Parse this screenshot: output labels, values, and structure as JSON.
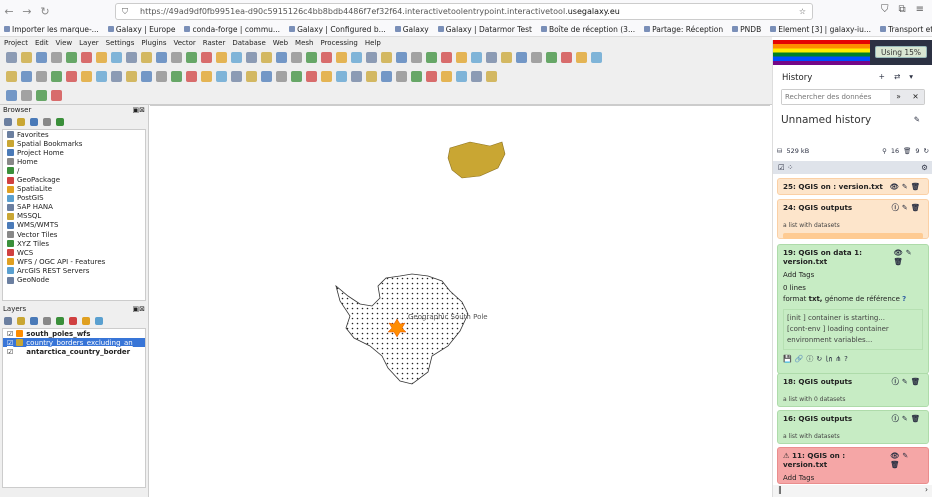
{
  "browser": {
    "url_prefix": "https://49ad9df0fb9951ea-d90c5915126c4bb8bdb4486f7ef32f64.interactivetoolentrypoint.interactivetool.",
    "url_domain": "usegalaxy.eu",
    "bookmarks": [
      "Importer les marque-...",
      "Galaxy | Europe",
      "conda-forge | commu...",
      "Galaxy | Configured b...",
      "Galaxy",
      "Galaxy | Datarmor Test",
      "Boîte de réception (3...",
      "Partage: Réception",
      "PNDB",
      "Element [3] | galaxy-iu...",
      "Transport et héberge..."
    ]
  },
  "qgis": {
    "menu": [
      "Project",
      "Edit",
      "View",
      "Layer",
      "Settings",
      "Plugins",
      "Vector",
      "Raster",
      "Database",
      "Web",
      "Mesh",
      "Processing",
      "Help"
    ],
    "browser_panel": {
      "title": "Browser",
      "items": [
        "Favorites",
        "Spatial Bookmarks",
        "Project Home",
        "Home",
        "/",
        "GeoPackage",
        "SpatiaLite",
        "PostGIS",
        "SAP HANA",
        "MSSQL",
        "WMS/WMTS",
        "Vector Tiles",
        "XYZ Tiles",
        "WCS",
        "WFS / OGC API - Features",
        "ArcGIS REST Servers",
        "GeoNode"
      ]
    },
    "layers_panel": {
      "title": "Layers",
      "layers": [
        "south_poles_wfs",
        "country_borders_excluding_an",
        "antarctica_country_border"
      ]
    },
    "map": {
      "label": "Geographic South Pole"
    }
  },
  "galaxy": {
    "quota": "Using 15%",
    "history_title": "History",
    "search_placeholder": "Rechercher des données",
    "history_name": "Unnamed history",
    "size": "529 kB",
    "shown": "16",
    "deleted": "9",
    "items": [
      {
        "title": "25: QGIS on : version.txt",
        "state": "queued"
      },
      {
        "title": "24: QGIS outputs",
        "state": "queued",
        "sub": "a list with datasets"
      },
      {
        "title": "19: QGIS on data 1: version.txt",
        "state": "ok",
        "tags": "Add Tags",
        "lines": "0 lines",
        "format_label": "format",
        "format": "txt,",
        "genome_label": "génome de référence",
        "genome": "?",
        "log": [
          "[init ] container is starting...",
          "[cont-env ] loading container environment variables..."
        ]
      },
      {
        "title": "18: QGIS outputs",
        "state": "ok",
        "sub": "a list with 0 datasets"
      },
      {
        "title": "16: QGIS outputs",
        "state": "ok",
        "sub": "a list with datasets"
      },
      {
        "title": "11: QGIS on : version.txt",
        "state": "error",
        "tags": "Add Tags"
      }
    ]
  }
}
